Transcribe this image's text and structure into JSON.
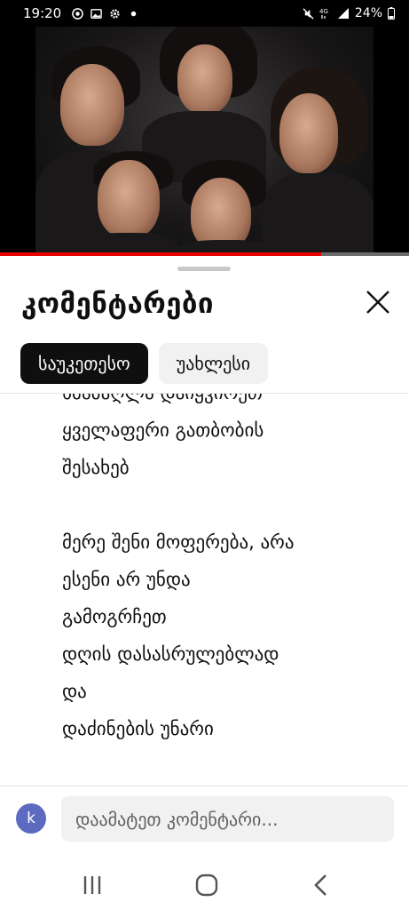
{
  "status_bar": {
    "time": "19:20",
    "battery": "24%",
    "icons_left": [
      "chrome-icon",
      "image-icon",
      "gear-icon",
      "dot-icon"
    ],
    "icons_right": [
      "mute-icon",
      "4g-signal-icon",
      "signal-icon",
      "battery-icon"
    ]
  },
  "video": {
    "progress_fraction": 0.785
  },
  "comments_sheet": {
    "title": "კომენტარები",
    "tabs": [
      {
        "label": "საუკეთესო",
        "active": true
      },
      {
        "label": "უახლესი",
        "active": false
      }
    ],
    "comment_text": "ხმამაღლა დაიყვირეთ\nყველაფერი გათბობის\nშესახებ\n\nმერე შენი მოფერება, არა\nესენი არ უნდა\nგამოგრჩეთ\nდღის დასასრულებლად\nდა\nდაძინების უნარი"
  },
  "comment_input": {
    "avatar_letter": "k",
    "placeholder": "დაამატეთ კომენტარი..."
  },
  "colors": {
    "progress": "#e60000",
    "chip_active_bg": "#0f0f0f",
    "chip_inactive_bg": "#f1f1f1",
    "avatar_bg": "#5c6bc0"
  }
}
